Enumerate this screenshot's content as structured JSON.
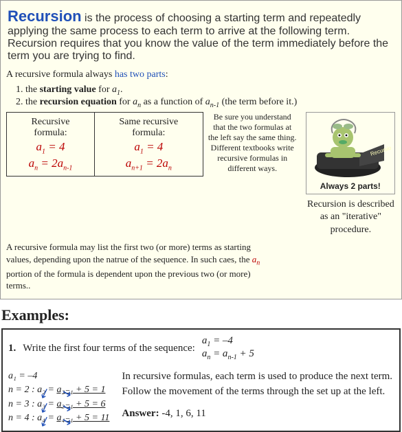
{
  "title": "Recursion",
  "intro": "is the process of choosing a starting term and repeatedly applying the same process to each term to arrive at the following term.  Recursion requires that you know the value of the term immediately before the term you are trying to find.",
  "parts": {
    "lead": "A recursive formula always ",
    "link": "has two parts",
    "li1a": "1.  the ",
    "li1b": "starting value",
    " li1c": " for ",
    "li2a": "2.  the ",
    "li2b": "recursion equation",
    " li2c": " for ",
    " li2d": " as a function of ",
    " li2e": " (the term before it.)"
  },
  "tbl": {
    "h1": "Recursive formula:",
    "h2": "Same recursive formula:",
    "a1": "a",
    " one": "1",
    " eq": " = 4",
    "an": "a",
    "n": "n",
    " eq2": " = 2a",
    "nm1": "n-1",
    "np1": "n+1"
  },
  "note": "Be sure you understand that the two formulas at the left say the same thing. Different textbooks write recursive formulas in different ways.",
  "caption": "Always 2 parts!",
  "desc1": "A recursive formula may list the first two (or more) terms as starting values, depending upon the natrue of the sequence. In such caes, the ",
  "desc2": " portion of the formula is dependent upon the previous two (or more) terms..",
  "rproc1": "Recursion is described as an \"iterative\" procedure.",
  "exHead": "Examples:",
  "q": {
    "num": "1.",
    "txt": "  Write the first four terms of the sequence:",
    "s1": "a",
    "s1i": "1",
    "s1v": " = -4",
    "s2": "a",
    "s2i": "n",
    "s2v": " = a",
    "s2j": "n-1",
    "s2w": " + 5"
  },
  "work": {
    "l0": "a₁ = –4",
    "l1": "n = 2 :   a₂ = a₂₋₁ + 5 = 1",
    "l2": "n = 3 :   a₃ = a₃₋₁ + 5 = 6",
    "l3": "n = 4 :   a₄ = a₄₋₁ + 5 = 11",
    "r": "In recursive formulas, each term is used to produce the next term.  Follow the movement of the terms through the set up at the left.",
    "ans": "Answer:",
    "ansv": "  -4, 1, 6, 11"
  }
}
